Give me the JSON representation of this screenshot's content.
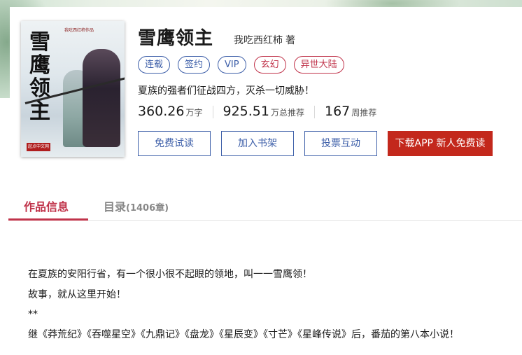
{
  "book": {
    "title": "雪鹰领主",
    "author": "我吃西红柿",
    "author_suffix": "著",
    "intro": "夏族的强者们征战四方，灭杀一切威胁！",
    "cover": {
      "title_chars": "雪鹰领主",
      "top_text": "我吃西红柿作品",
      "publisher": "起点中文网"
    }
  },
  "tags": [
    {
      "label": "连载",
      "color": "#3c5ea8"
    },
    {
      "label": "签约",
      "color": "#3c5ea8"
    },
    {
      "label": "VIP",
      "color": "#3c5ea8"
    },
    {
      "label": "玄幻",
      "color": "#c0334a"
    },
    {
      "label": "异世大陆",
      "color": "#c0334a"
    }
  ],
  "stats": [
    {
      "value": "360.26",
      "unit": "万字"
    },
    {
      "value": "925.51",
      "unit": "万总推荐"
    },
    {
      "value": "167",
      "unit": "周推荐"
    }
  ],
  "buttons": {
    "free_trial": "免费试读",
    "add_shelf": "加入书架",
    "vote": "投票互动",
    "download": "下载APP 新人免费读"
  },
  "tabs": {
    "info": "作品信息",
    "catalog": "目录",
    "catalog_count": "(1406章)"
  },
  "description": [
    "在夏族的安阳行省，有一个很小很不起眼的领地，叫一一雪鹰领！",
    "故事，就从这里开始！",
    "**",
    "继《莽荒纪》《吞噬星空》《九鼎记》《盘龙》《星辰变》《寸芒》《星峰传说》后，番茄的第八本小说！"
  ],
  "colors": {
    "accent_red": "#c0334a",
    "button_blue": "#3c5ea8",
    "primary_button": "#c3281c"
  }
}
